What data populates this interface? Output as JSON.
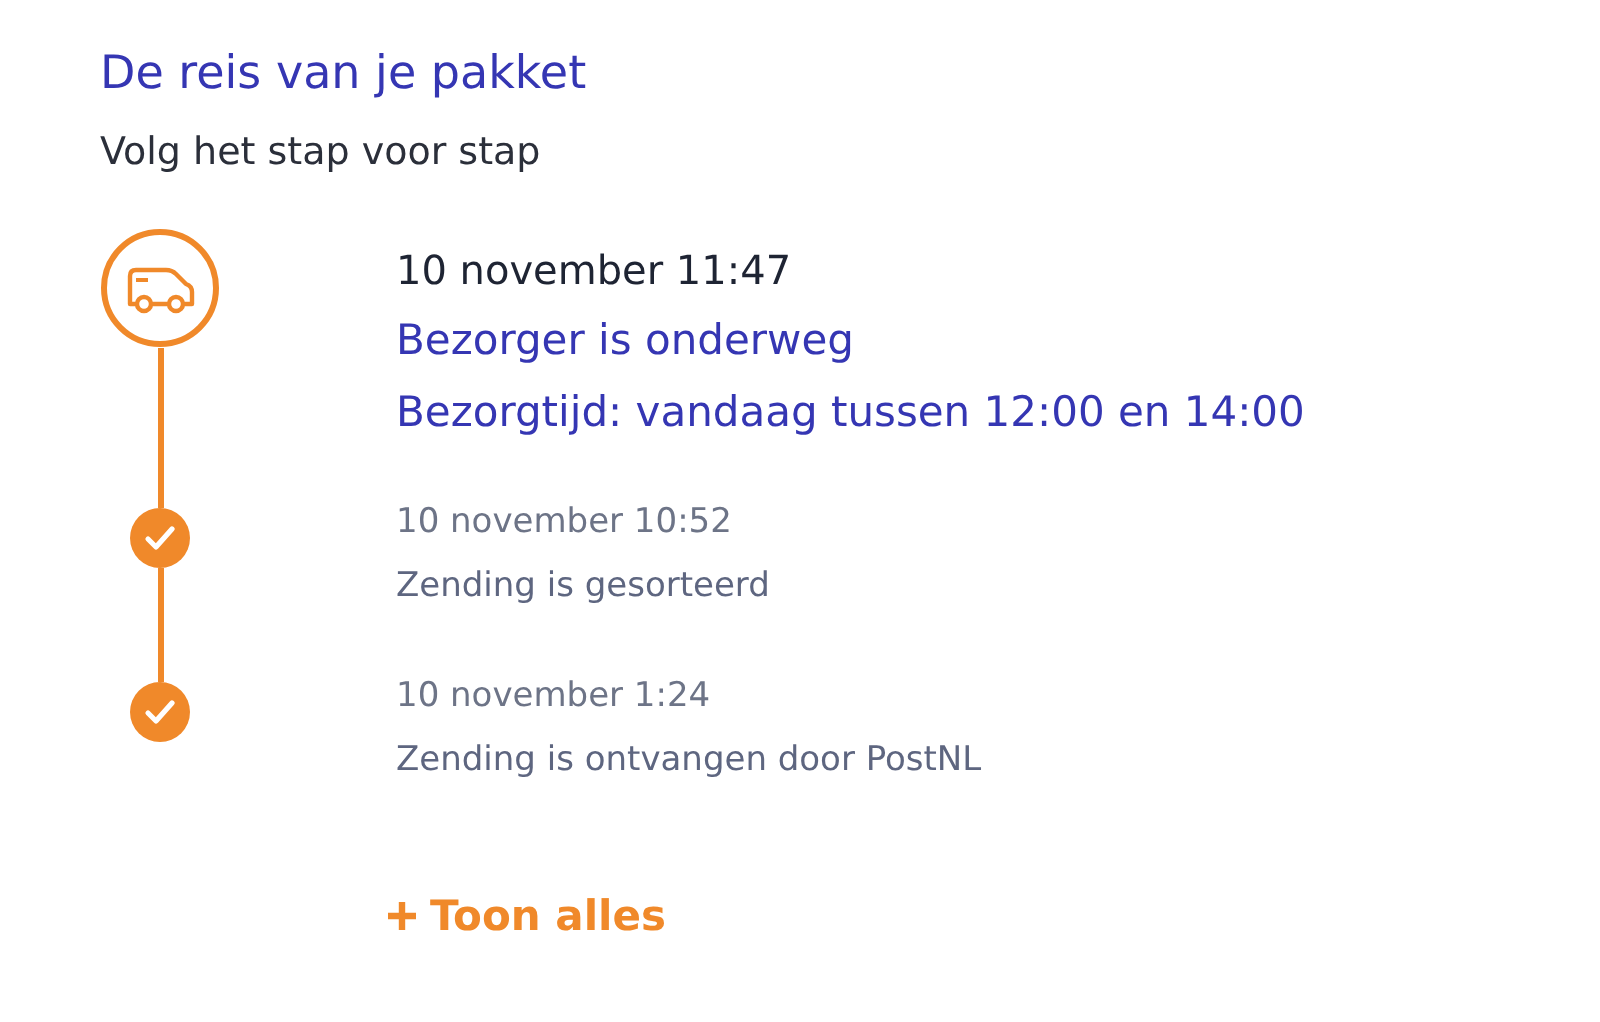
{
  "title": "De reis van je pakket",
  "subtitle": "Volg het stap voor stap",
  "events": [
    {
      "kind": "current",
      "date": "10 november 11:47",
      "lines": [
        "Bezorger is onderweg",
        "Bezorgtijd: vandaag tussen 12:00 en 14:00"
      ]
    },
    {
      "kind": "done",
      "date": "10 november 10:52",
      "lines": [
        "Zending is gesorteerd"
      ]
    },
    {
      "kind": "done",
      "date": "10 november 1:24",
      "lines": [
        "Zending is ontvangen door PostNL"
      ]
    }
  ],
  "show_all": "Toon alles"
}
